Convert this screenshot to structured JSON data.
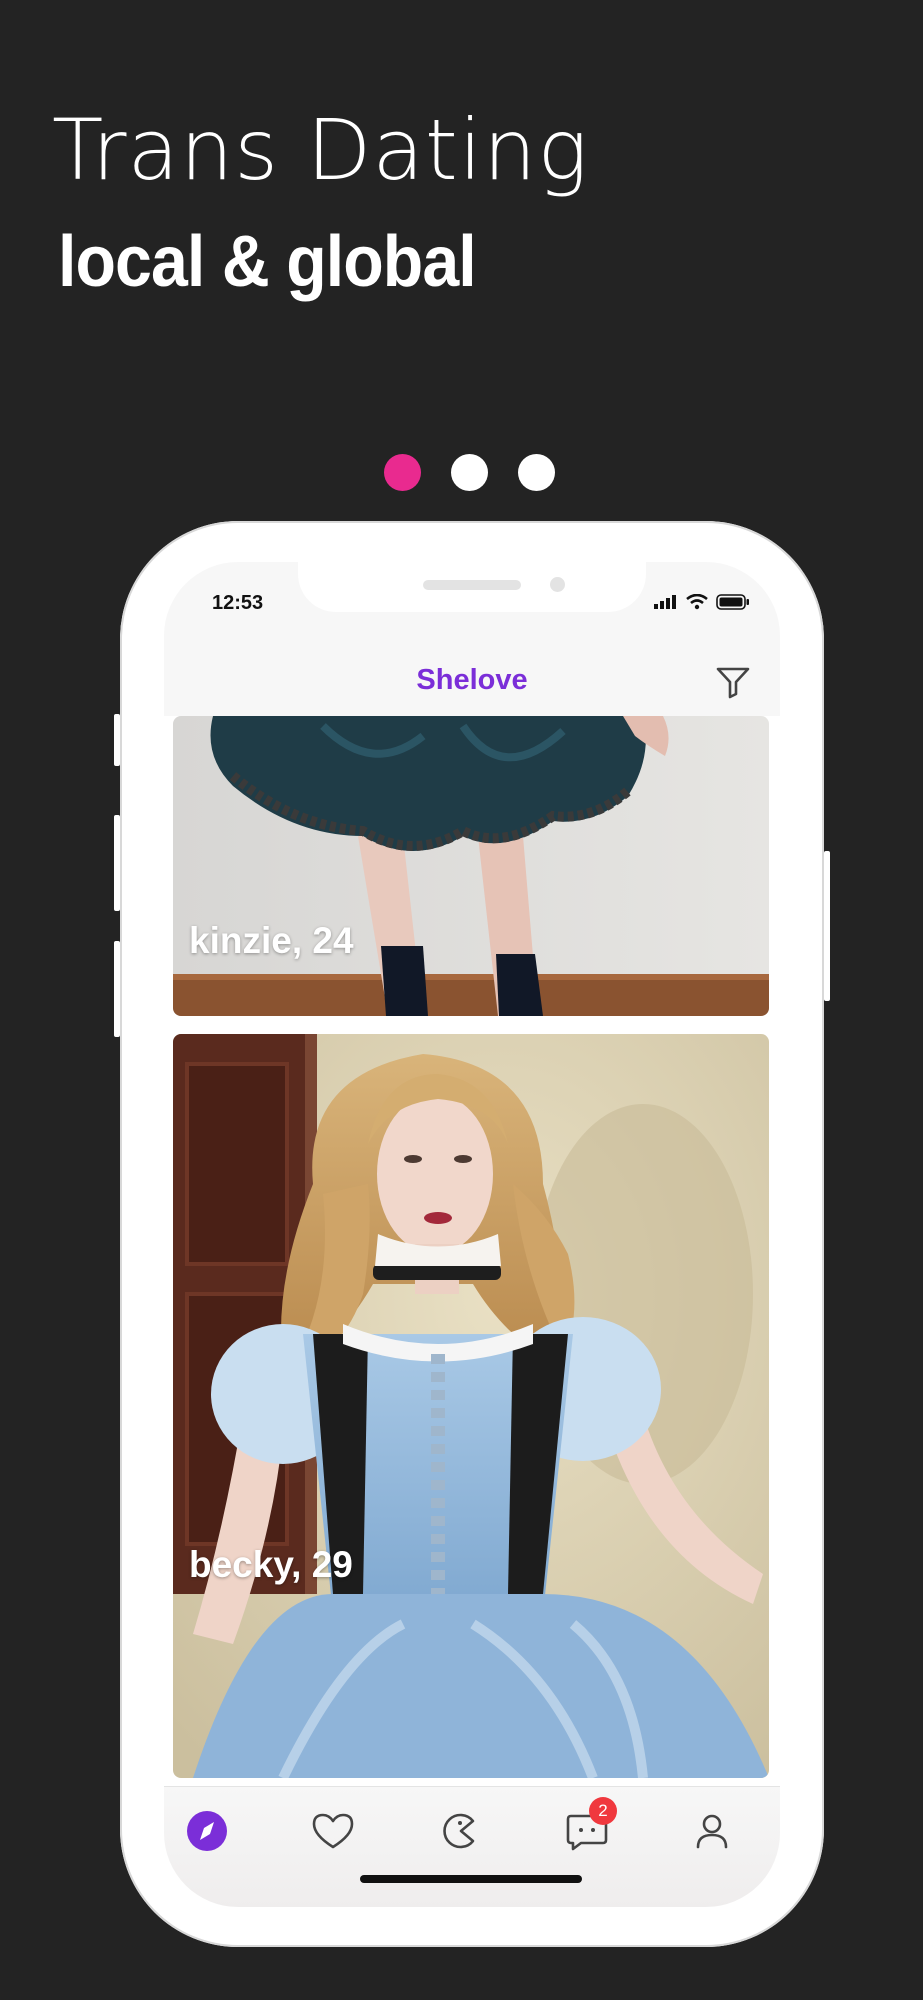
{
  "promo": {
    "headline": "Trans Dating",
    "subline": "local & global",
    "pagination": {
      "total": 3,
      "active_index": 0
    }
  },
  "status_bar": {
    "time": "12:53"
  },
  "nav": {
    "title": "Shelove",
    "filter_icon": "filter-icon"
  },
  "profiles": [
    {
      "name_age": "kinzie, 24"
    },
    {
      "name_age": "becky, 29"
    }
  ],
  "tab_bar": {
    "items": [
      {
        "icon": "compass-icon",
        "active": true
      },
      {
        "icon": "heart-icon",
        "active": false
      },
      {
        "icon": "pacman-icon",
        "active": false
      },
      {
        "icon": "chat-icon",
        "active": false,
        "badge": "2"
      },
      {
        "icon": "profile-icon",
        "active": false
      }
    ]
  },
  "colors": {
    "accent": "#7b2ed8",
    "dot_active": "#e92a8f",
    "badge": "#f0383e",
    "background": "#232323"
  }
}
